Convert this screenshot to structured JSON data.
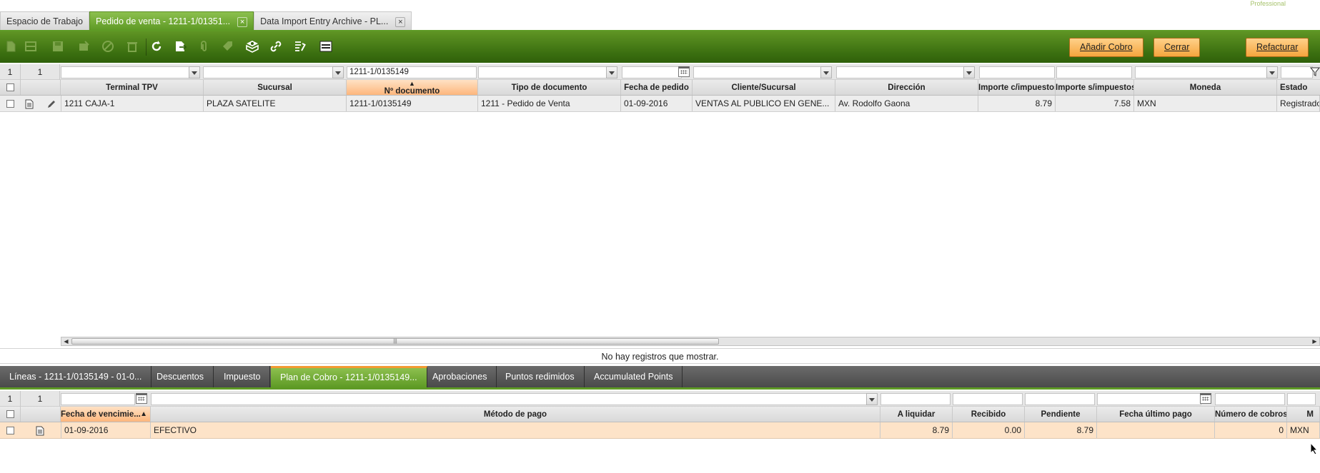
{
  "window_tabs": [
    {
      "label": "Espacio de Trabajo",
      "closable": false,
      "active": false
    },
    {
      "label": "Pedido de venta - 1211-1/01351...",
      "closable": true,
      "active": true
    },
    {
      "label": "Data Import Entry Archive - PL...",
      "closable": true,
      "active": false
    }
  ],
  "close_glyph": "×",
  "corner_label": "Professional",
  "toolbar": {
    "icons": [
      "new-document-icon",
      "new-grid-icon",
      "save-icon",
      "delete-icon",
      "cancel-icon",
      "trash-icon",
      "refresh-icon",
      "export-icon",
      "attach-icon",
      "tag-icon",
      "process-icon",
      "link-icon",
      "audit-icon",
      "toggle-view-icon"
    ],
    "add_payment": "Añadir Cobro",
    "close": "Cerrar",
    "reinvoice": "Refacturar"
  },
  "main_grid": {
    "row_number": "1",
    "selected_count": "1",
    "filter_document": "1211-1/0135149",
    "columns": [
      "Terminal TPV",
      "Sucursal",
      "Nº documento",
      "Tipo de documento",
      "Fecha de pedido",
      "Cliente/Sucursal",
      "Dirección",
      "Importe c/impuestos",
      "Importe s/impuestos",
      "Moneda",
      "Estado"
    ],
    "sort_glyph": "▲",
    "rows": [
      [
        "1211 CAJA-1",
        "PLAZA SATELITE",
        "1211-1/0135149",
        "1211 - Pedido de Venta",
        "01-09-2016",
        "VENTAS AL PUBLICO EN GENE...",
        "Av. Rodolfo Gaona",
        "8.79",
        "7.58",
        "MXN",
        "Registrado"
      ]
    ],
    "scroll_grip": "|||"
  },
  "message": "No hay registros que mostrar.",
  "sub_tabs": [
    {
      "label": "Líneas - 1211-1/0135149 - 01-0...",
      "active": false
    },
    {
      "label": "Descuentos",
      "active": false
    },
    {
      "label": "Impuesto",
      "active": false
    },
    {
      "label": "Plan de Cobro - 1211-1/0135149...",
      "active": true
    },
    {
      "label": "Aprobaciones",
      "active": false
    },
    {
      "label": "Puntos redimidos",
      "active": false
    },
    {
      "label": "Accumulated Points",
      "active": false
    }
  ],
  "sub_grid": {
    "row_number": "1",
    "selected_count": "1",
    "columns": [
      "Fecha de vencimie...",
      "Método de pago",
      "A liquidar",
      "Recibido",
      "Pendiente",
      "Fecha último pago",
      "Número de cobros",
      "M"
    ],
    "rows": [
      [
        "01-09-2016",
        "EFECTIVO",
        "8.79",
        "0.00",
        "8.79",
        "",
        "0",
        "MXN"
      ]
    ]
  },
  "colors": {
    "green": "#5e9a25",
    "orange": "#f5a53d",
    "sorted": "#fdb67c",
    "selected_row": "#fde3c8"
  }
}
